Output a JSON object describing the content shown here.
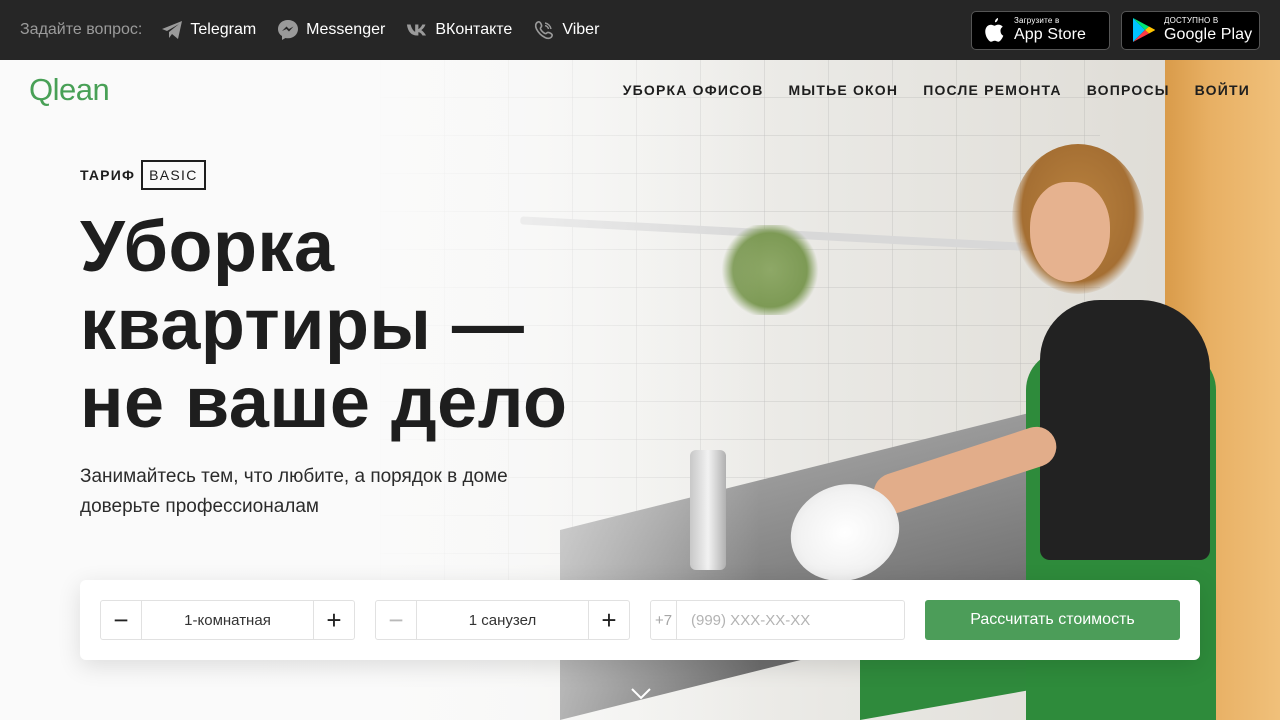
{
  "topbar": {
    "ask_label": "Задайте вопрос:",
    "messengers": [
      {
        "label": "Telegram",
        "icon": "telegram-icon"
      },
      {
        "label": "Messenger",
        "icon": "messenger-icon"
      },
      {
        "label": "ВКонтакте",
        "icon": "vk-icon"
      },
      {
        "label": "Viber",
        "icon": "viber-icon"
      }
    ],
    "stores": [
      {
        "small": "Загрузите в",
        "big": "App Store",
        "icon": "apple-icon"
      },
      {
        "small": "ДОСТУПНО В",
        "big": "Google Play",
        "icon": "google-play-icon"
      }
    ]
  },
  "header": {
    "logo": "Qlean",
    "nav": [
      "УБОРКА ОФИСОВ",
      "МЫТЬЕ ОКОН",
      "ПОСЛЕ РЕМОНТА",
      "ВОПРОСЫ",
      "ВОЙТИ"
    ]
  },
  "hero": {
    "tariff_label": "ТАРИФ",
    "tariff_name": "BASIC",
    "headline": [
      "Уборка",
      "квартиры —",
      "не ваше дело"
    ],
    "subtitle": "Занимайтесь тем, что любите, а порядок в доме доверьте профессионалам"
  },
  "form": {
    "rooms": {
      "minus": "−",
      "value": "1-комнатная",
      "plus": "+"
    },
    "bathrooms": {
      "minus": "−",
      "value": "1 санузел",
      "plus": "+"
    },
    "phone": {
      "prefix": "+7",
      "placeholder": "(999) XXX-XX-XX",
      "value": ""
    },
    "submit_label": "Рассчитать стоимость"
  },
  "colors": {
    "brand_green": "#48a056",
    "button_green": "#4c9d59",
    "topbar_bg": "#262626"
  }
}
